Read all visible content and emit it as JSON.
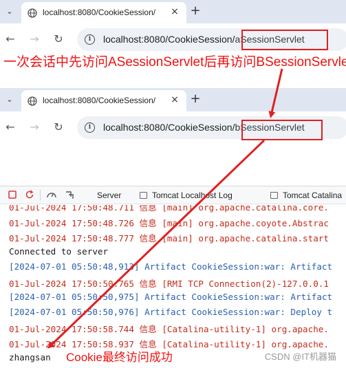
{
  "browser1": {
    "tab_title": "localhost:8080/CookieSession/",
    "tab_close": "×",
    "new_tab": "+",
    "url_host": "localhost:8080/CookieSession/",
    "url_path": "aSessionServlet"
  },
  "browser2": {
    "tab_title": "localhost:8080/CookieSession/",
    "tab_close": "×",
    "new_tab": "+",
    "url_host": "localhost:8080/CookieSession/",
    "url_path": "bSessionServlet"
  },
  "annotations": {
    "top": "一次会话中先访问ASessionServlet后再访问BSessionServlet",
    "bottom": "Cookie最终访问成功"
  },
  "console": {
    "tabs": [
      {
        "label": "Server"
      },
      {
        "label": "Tomcat Localhost Log"
      },
      {
        "label": "Tomcat Catalina"
      }
    ],
    "lines": [
      {
        "text": "01-Jul-2024 17:50:48.711 信息 [main] org.apache.catalina.core.",
        "color": "red"
      },
      {
        "text": "01-Jul-2024 17:50:48.726 信息 [main] org.apache.coyote.Abstrac",
        "color": "red"
      },
      {
        "text": "01-Jul-2024 17:50:48.777 信息 [main] org.apache.catalina.start",
        "color": "red"
      },
      {
        "text": "Connected to server",
        "color": "black"
      },
      {
        "text": "[2024-07-01 05:50:48,913] Artifact CookieSession:war: Artifact",
        "color": "blue"
      },
      {
        "text": "01-Jul-2024 17:50:50.765 信息 [RMI TCP Connection(2)-127.0.0.1",
        "color": "red"
      },
      {
        "text": "[2024-07-01 05:50:50,975] Artifact CookieSession:war: Artifact",
        "color": "blue"
      },
      {
        "text": "[2024-07-01 05:50:50,976] Artifact CookieSession:war: Deploy t",
        "color": "blue"
      },
      {
        "text": "01-Jul-2024 17:50:58.744 信息 [Catalina-utility-1] org.apache.",
        "color": "red"
      },
      {
        "text": "01-Jul-2024 17:50:58.937 信息 [Catalina-utility-1] org.apache.",
        "color": "red"
      },
      {
        "text": "zhangsan",
        "color": "black"
      }
    ]
  },
  "watermark": "CSDN @IT机器猫",
  "colors": {
    "annotation": "#f01010",
    "log_red": "#c42b1c",
    "log_blue": "#2a5fb0",
    "tabbar": "#dfe6f1"
  }
}
